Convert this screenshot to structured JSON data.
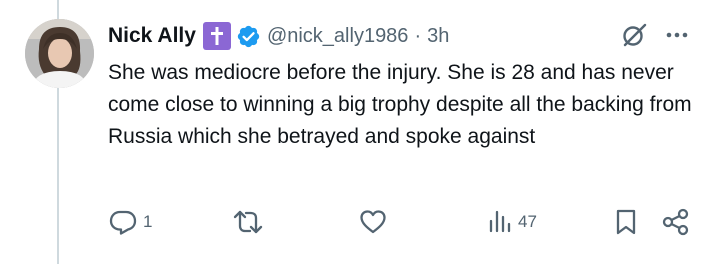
{
  "tweet": {
    "author": {
      "display_name": "Nick Ally",
      "handle": "@nick_ally1986",
      "badge_icons": [
        "latin-cross-icon",
        "verified-badge-icon"
      ]
    },
    "separator": "·",
    "timestamp": "3h",
    "text": "She was mediocre before the injury. She is 28 and has never come close to winning a big trophy despite all the backing from Russia which she betrayed and spoke against",
    "actions": {
      "reply": {
        "icon": "reply-icon",
        "count": "1"
      },
      "retweet": {
        "icon": "retweet-icon"
      },
      "like": {
        "icon": "heart-icon"
      },
      "views": {
        "icon": "views-icon",
        "count": "47"
      },
      "bookmark": {
        "icon": "bookmark-icon"
      },
      "share": {
        "icon": "share-icon"
      }
    },
    "header_icons": [
      "grok-icon",
      "more-icon"
    ]
  },
  "colors": {
    "text_primary": "#0f1419",
    "text_secondary": "#536471",
    "verified_blue": "#1d9bf0",
    "cross_badge_purple": "#8b67d4",
    "thread_line": "#cfd9de"
  }
}
